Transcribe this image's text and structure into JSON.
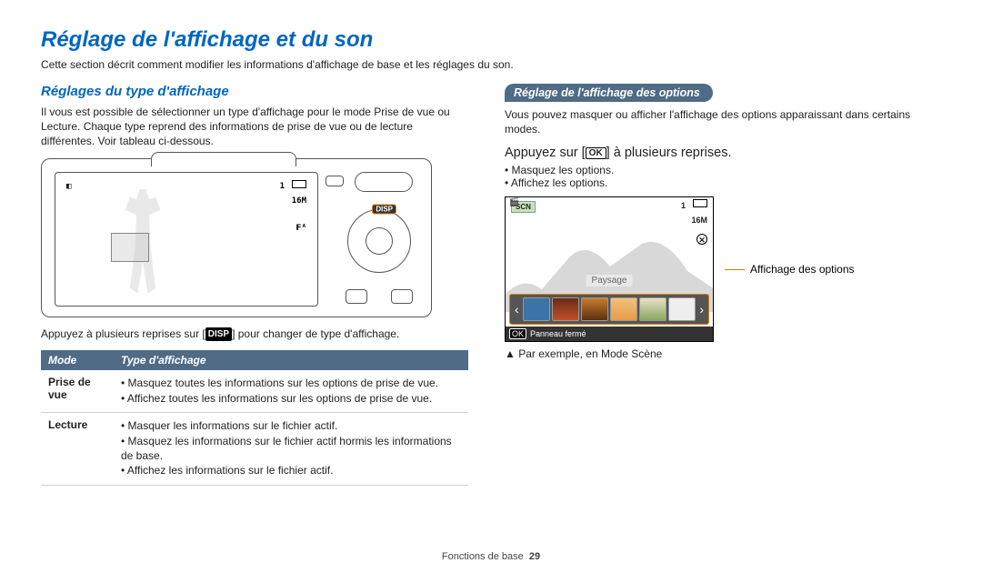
{
  "title": "Réglage de l'affichage et du son",
  "intro": "Cette section décrit comment modifier les informations d'affichage de base et les réglages du son.",
  "left": {
    "heading": "Réglages du type d'affichage",
    "para": "Il vous est possible de sélectionner un type d'affichage pour le mode Prise de vue ou Lecture. Chaque type reprend des informations de prise de vue ou de lecture différentes. Voir tableau ci-dessous.",
    "camera": {
      "counter": "1",
      "res": "16M",
      "flash": "𝗙ᴬ",
      "disp": "DISP"
    },
    "press_pre": "Appuyez à plusieurs reprises sur [",
    "press_disp": "DISP",
    "press_post": "] pour changer de type d'affichage.",
    "table": {
      "h1": "Mode",
      "h2": "Type d'affichage",
      "r1_mode": "Prise de vue",
      "r1_items": [
        "Masquez toutes les informations sur les options de prise de vue.",
        "Affichez toutes les informations sur les options de prise de vue."
      ],
      "r2_mode": "Lecture",
      "r2_items": [
        "Masquer les informations sur le fichier actif.",
        "Masquez les informations sur le fichier actif hormis les informations de base.",
        "Affichez les informations sur le fichier actif."
      ]
    }
  },
  "right": {
    "pill": "Réglage de l'affichage des options",
    "para": "Vous pouvez masquer ou afficher l'affichage des options apparaissant dans certains modes.",
    "instr_pre": "Appuyez sur [",
    "instr_ok": "OK",
    "instr_post": "] à plusieurs reprises.",
    "bullets": [
      "Masquez les options.",
      "Affichez les options."
    ],
    "scene": {
      "counter": "1",
      "res": "16M",
      "label": "Paysage",
      "footer_ok": "OK",
      "footer_text": "Panneau fermé"
    },
    "callout": "Affichage des options",
    "caption_tri": "▲",
    "caption": "Par exemple, en Mode Scène",
    "chart_data": {
      "type": "table",
      "note": "option thumbnails colors",
      "options": [
        "#3c74a5",
        "#6b2b1a",
        "#c97c2b",
        "#f0c27a",
        "#8aa760",
        "#eeeeee"
      ]
    }
  },
  "footer": {
    "section": "Fonctions de base",
    "page": "29"
  }
}
